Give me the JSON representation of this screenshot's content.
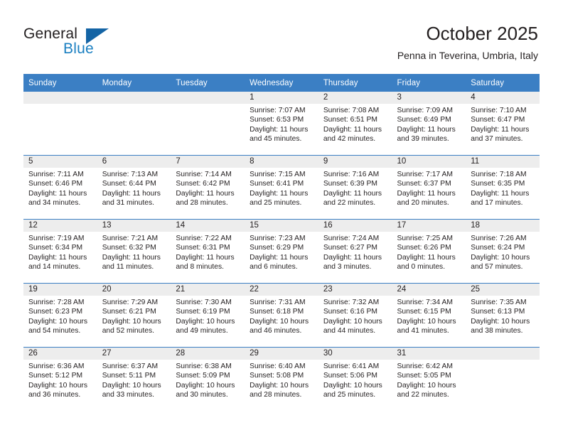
{
  "brand": {
    "word_one": "General",
    "word_two": "Blue",
    "triangle_icon": "brand-triangle-icon",
    "accent_color": "#1a7fc1",
    "triangle_color": "#1464a5"
  },
  "header": {
    "title": "October 2025",
    "subtitle": "Penna in Teverina, Umbria, Italy"
  },
  "colors": {
    "header_row": "#3b7fc4",
    "daynum_strip": "#ededed",
    "text": "#231f20"
  },
  "calendar": {
    "weekday_headers": [
      "Sunday",
      "Monday",
      "Tuesday",
      "Wednesday",
      "Thursday",
      "Friday",
      "Saturday"
    ],
    "weeks": [
      [
        {
          "day": "",
          "sunrise": "",
          "sunset": "",
          "daylight_line1": "",
          "daylight_line2": "",
          "empty": true
        },
        {
          "day": "",
          "sunrise": "",
          "sunset": "",
          "daylight_line1": "",
          "daylight_line2": "",
          "empty": true
        },
        {
          "day": "",
          "sunrise": "",
          "sunset": "",
          "daylight_line1": "",
          "daylight_line2": "",
          "empty": true
        },
        {
          "day": "1",
          "sunrise": "Sunrise: 7:07 AM",
          "sunset": "Sunset: 6:53 PM",
          "daylight_line1": "Daylight: 11 hours",
          "daylight_line2": "and 45 minutes."
        },
        {
          "day": "2",
          "sunrise": "Sunrise: 7:08 AM",
          "sunset": "Sunset: 6:51 PM",
          "daylight_line1": "Daylight: 11 hours",
          "daylight_line2": "and 42 minutes."
        },
        {
          "day": "3",
          "sunrise": "Sunrise: 7:09 AM",
          "sunset": "Sunset: 6:49 PM",
          "daylight_line1": "Daylight: 11 hours",
          "daylight_line2": "and 39 minutes."
        },
        {
          "day": "4",
          "sunrise": "Sunrise: 7:10 AM",
          "sunset": "Sunset: 6:47 PM",
          "daylight_line1": "Daylight: 11 hours",
          "daylight_line2": "and 37 minutes."
        }
      ],
      [
        {
          "day": "5",
          "sunrise": "Sunrise: 7:11 AM",
          "sunset": "Sunset: 6:46 PM",
          "daylight_line1": "Daylight: 11 hours",
          "daylight_line2": "and 34 minutes."
        },
        {
          "day": "6",
          "sunrise": "Sunrise: 7:13 AM",
          "sunset": "Sunset: 6:44 PM",
          "daylight_line1": "Daylight: 11 hours",
          "daylight_line2": "and 31 minutes."
        },
        {
          "day": "7",
          "sunrise": "Sunrise: 7:14 AM",
          "sunset": "Sunset: 6:42 PM",
          "daylight_line1": "Daylight: 11 hours",
          "daylight_line2": "and 28 minutes."
        },
        {
          "day": "8",
          "sunrise": "Sunrise: 7:15 AM",
          "sunset": "Sunset: 6:41 PM",
          "daylight_line1": "Daylight: 11 hours",
          "daylight_line2": "and 25 minutes."
        },
        {
          "day": "9",
          "sunrise": "Sunrise: 7:16 AM",
          "sunset": "Sunset: 6:39 PM",
          "daylight_line1": "Daylight: 11 hours",
          "daylight_line2": "and 22 minutes."
        },
        {
          "day": "10",
          "sunrise": "Sunrise: 7:17 AM",
          "sunset": "Sunset: 6:37 PM",
          "daylight_line1": "Daylight: 11 hours",
          "daylight_line2": "and 20 minutes."
        },
        {
          "day": "11",
          "sunrise": "Sunrise: 7:18 AM",
          "sunset": "Sunset: 6:35 PM",
          "daylight_line1": "Daylight: 11 hours",
          "daylight_line2": "and 17 minutes."
        }
      ],
      [
        {
          "day": "12",
          "sunrise": "Sunrise: 7:19 AM",
          "sunset": "Sunset: 6:34 PM",
          "daylight_line1": "Daylight: 11 hours",
          "daylight_line2": "and 14 minutes."
        },
        {
          "day": "13",
          "sunrise": "Sunrise: 7:21 AM",
          "sunset": "Sunset: 6:32 PM",
          "daylight_line1": "Daylight: 11 hours",
          "daylight_line2": "and 11 minutes."
        },
        {
          "day": "14",
          "sunrise": "Sunrise: 7:22 AM",
          "sunset": "Sunset: 6:31 PM",
          "daylight_line1": "Daylight: 11 hours",
          "daylight_line2": "and 8 minutes."
        },
        {
          "day": "15",
          "sunrise": "Sunrise: 7:23 AM",
          "sunset": "Sunset: 6:29 PM",
          "daylight_line1": "Daylight: 11 hours",
          "daylight_line2": "and 6 minutes."
        },
        {
          "day": "16",
          "sunrise": "Sunrise: 7:24 AM",
          "sunset": "Sunset: 6:27 PM",
          "daylight_line1": "Daylight: 11 hours",
          "daylight_line2": "and 3 minutes."
        },
        {
          "day": "17",
          "sunrise": "Sunrise: 7:25 AM",
          "sunset": "Sunset: 6:26 PM",
          "daylight_line1": "Daylight: 11 hours",
          "daylight_line2": "and 0 minutes."
        },
        {
          "day": "18",
          "sunrise": "Sunrise: 7:26 AM",
          "sunset": "Sunset: 6:24 PM",
          "daylight_line1": "Daylight: 10 hours",
          "daylight_line2": "and 57 minutes."
        }
      ],
      [
        {
          "day": "19",
          "sunrise": "Sunrise: 7:28 AM",
          "sunset": "Sunset: 6:23 PM",
          "daylight_line1": "Daylight: 10 hours",
          "daylight_line2": "and 54 minutes."
        },
        {
          "day": "20",
          "sunrise": "Sunrise: 7:29 AM",
          "sunset": "Sunset: 6:21 PM",
          "daylight_line1": "Daylight: 10 hours",
          "daylight_line2": "and 52 minutes."
        },
        {
          "day": "21",
          "sunrise": "Sunrise: 7:30 AM",
          "sunset": "Sunset: 6:19 PM",
          "daylight_line1": "Daylight: 10 hours",
          "daylight_line2": "and 49 minutes."
        },
        {
          "day": "22",
          "sunrise": "Sunrise: 7:31 AM",
          "sunset": "Sunset: 6:18 PM",
          "daylight_line1": "Daylight: 10 hours",
          "daylight_line2": "and 46 minutes."
        },
        {
          "day": "23",
          "sunrise": "Sunrise: 7:32 AM",
          "sunset": "Sunset: 6:16 PM",
          "daylight_line1": "Daylight: 10 hours",
          "daylight_line2": "and 44 minutes."
        },
        {
          "day": "24",
          "sunrise": "Sunrise: 7:34 AM",
          "sunset": "Sunset: 6:15 PM",
          "daylight_line1": "Daylight: 10 hours",
          "daylight_line2": "and 41 minutes."
        },
        {
          "day": "25",
          "sunrise": "Sunrise: 7:35 AM",
          "sunset": "Sunset: 6:13 PM",
          "daylight_line1": "Daylight: 10 hours",
          "daylight_line2": "and 38 minutes."
        }
      ],
      [
        {
          "day": "26",
          "sunrise": "Sunrise: 6:36 AM",
          "sunset": "Sunset: 5:12 PM",
          "daylight_line1": "Daylight: 10 hours",
          "daylight_line2": "and 36 minutes."
        },
        {
          "day": "27",
          "sunrise": "Sunrise: 6:37 AM",
          "sunset": "Sunset: 5:11 PM",
          "daylight_line1": "Daylight: 10 hours",
          "daylight_line2": "and 33 minutes."
        },
        {
          "day": "28",
          "sunrise": "Sunrise: 6:38 AM",
          "sunset": "Sunset: 5:09 PM",
          "daylight_line1": "Daylight: 10 hours",
          "daylight_line2": "and 30 minutes."
        },
        {
          "day": "29",
          "sunrise": "Sunrise: 6:40 AM",
          "sunset": "Sunset: 5:08 PM",
          "daylight_line1": "Daylight: 10 hours",
          "daylight_line2": "and 28 minutes."
        },
        {
          "day": "30",
          "sunrise": "Sunrise: 6:41 AM",
          "sunset": "Sunset: 5:06 PM",
          "daylight_line1": "Daylight: 10 hours",
          "daylight_line2": "and 25 minutes."
        },
        {
          "day": "31",
          "sunrise": "Sunrise: 6:42 AM",
          "sunset": "Sunset: 5:05 PM",
          "daylight_line1": "Daylight: 10 hours",
          "daylight_line2": "and 22 minutes."
        },
        {
          "day": "",
          "sunrise": "",
          "sunset": "",
          "daylight_line1": "",
          "daylight_line2": "",
          "empty": true
        }
      ]
    ]
  }
}
